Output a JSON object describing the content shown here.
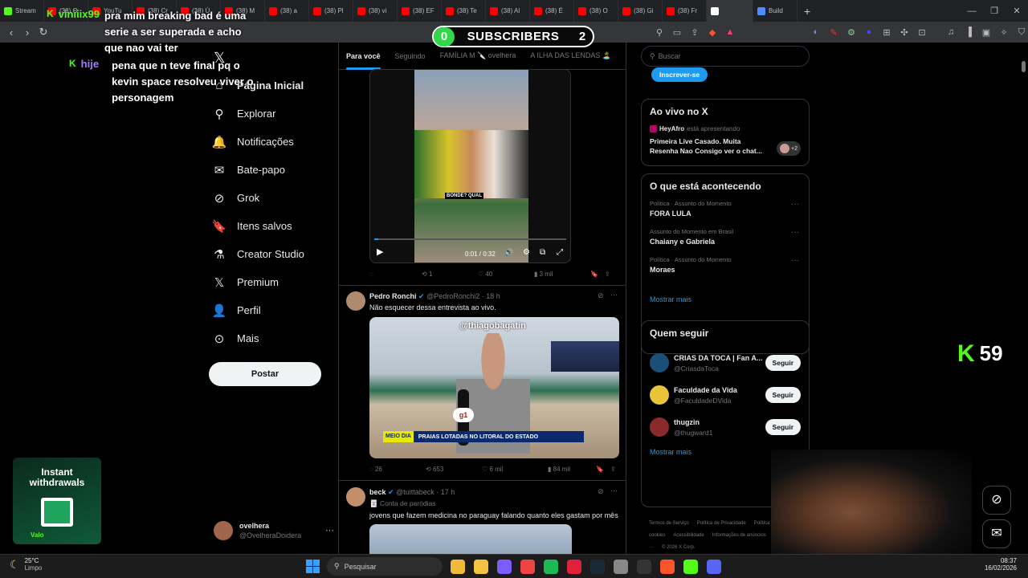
{
  "browser": {
    "tabs": [
      {
        "label": "Stream",
        "color": "#53fc18"
      },
      {
        "label": "(38) O",
        "color": "#ff0000"
      },
      {
        "label": "YouTu",
        "color": "#ff0000"
      },
      {
        "label": "(38) Cr",
        "color": "#ff0000"
      },
      {
        "label": "(38) Ú",
        "color": "#ff0000"
      },
      {
        "label": "(38) M",
        "color": "#ff0000"
      },
      {
        "label": "(38) a",
        "color": "#ff0000"
      },
      {
        "label": "(38) Pl",
        "color": "#ff0000"
      },
      {
        "label": "(38) vi",
        "color": "#ff0000"
      },
      {
        "label": "(38) EF",
        "color": "#ff0000"
      },
      {
        "label": "(38) Te",
        "color": "#ff0000"
      },
      {
        "label": "(38) Al",
        "color": "#ff0000"
      },
      {
        "label": "(38) É",
        "color": "#ff0000"
      },
      {
        "label": "(38) O",
        "color": "#ff0000"
      },
      {
        "label": "(38) Gi",
        "color": "#ff0000"
      },
      {
        "label": "(38) Fr",
        "color": "#ff0000"
      },
      {
        "label": "",
        "color": "#ffffff"
      },
      {
        "label": "Build",
        "color": "#4f8cff"
      }
    ],
    "new_tab": "+"
  },
  "overlay": {
    "chat": [
      {
        "user": "viniiix99",
        "message": "pra mim breaking bad é uma serie a ser superada e acho que nao vai ter",
        "user_color": "#53fc18"
      },
      {
        "user": "hije",
        "message": "pena que n teve final pq o kevin space resolveu viver o personagem",
        "user_color": "#a77bff"
      }
    ],
    "subscribers": {
      "current": "0",
      "label": "SUBSCRIBERS",
      "goal": "2"
    },
    "kick_counter": "59",
    "ad": {
      "title": "Instant withdrawals",
      "tag": "Valo"
    }
  },
  "x": {
    "nav": [
      {
        "label": "Página Inicial",
        "icon": "home-icon",
        "glyph": "⌂"
      },
      {
        "label": "Explorar",
        "icon": "search-icon",
        "glyph": "⚲"
      },
      {
        "label": "Notificações",
        "icon": "bell-icon",
        "glyph": "🔔"
      },
      {
        "label": "Bate-papo",
        "icon": "mail-icon",
        "glyph": "✉"
      },
      {
        "label": "Grok",
        "icon": "grok-icon",
        "glyph": "⊘"
      },
      {
        "label": "Itens salvos",
        "icon": "bookmark-icon",
        "glyph": "🔖"
      },
      {
        "label": "Creator Studio",
        "icon": "flask-icon",
        "glyph": "⚗"
      },
      {
        "label": "Premium",
        "icon": "x-logo-icon",
        "glyph": "𝕏"
      },
      {
        "label": "Perfil",
        "icon": "person-icon",
        "glyph": "👤"
      },
      {
        "label": "Mais",
        "icon": "more-circle-icon",
        "glyph": "⊙"
      }
    ],
    "post_button": "Postar",
    "account": {
      "name": "ovelhera",
      "handle": "@OvelheraDoidera"
    },
    "feed_tabs": [
      "Para você",
      "Seguindo",
      "FAMÍLIA M 🔪 ovelhera",
      "A ILHA DAS LENDAS 🏝️"
    ],
    "video1": {
      "caption": "BONDE? QUAL",
      "time": "0:01 / 0:32",
      "replies": "",
      "reposts": "1",
      "likes": "40",
      "views": "3 mil"
    },
    "tweet2": {
      "name": "Pedro Ronchi",
      "handle": "@PedroRonchi2",
      "time": "· 18 h",
      "text": "Não esquecer dessa entrevista ao vivo.",
      "overlay_handle": "@thiagobagatin",
      "headline": "PRAIAS LOTADAS NO LITORAL DO ESTADO",
      "show": "MEIO DIA",
      "replies": "26",
      "reposts": "653",
      "likes": "6 mil",
      "views": "84 mil"
    },
    "tweet3": {
      "name": "beck",
      "handle": "@tuittabeck",
      "time": "· 17 h",
      "parody": "Conta de paródias",
      "text": "jovens que fazem medicina no paraguay falando quanto eles gastam por mês"
    },
    "search_placeholder": "Buscar",
    "subscribe_button": "Inscrever-se",
    "live": {
      "title": "Ao vivo no X",
      "host": "HeyAfro",
      "status": "está apresentando",
      "text": "Primeira Live Casado. Muita Resenha Nao Consigo ver o chat...",
      "extra": "+2"
    },
    "happening": {
      "title": "O que está acontecendo",
      "trends": [
        {
          "category": "Política · Assunto do Momento",
          "name": "FORA LULA"
        },
        {
          "category": "Assunto do Momento em Brasil",
          "name": "Chaiany e Gabriela"
        },
        {
          "category": "Política · Assunto do Momento",
          "name": "Moraes"
        }
      ],
      "more": "Mostrar mais"
    },
    "who_to_follow": {
      "title": "Quem seguir",
      "users": [
        {
          "name": "CRIAS DA TOCA | Fan A...",
          "handle": "@CriasdaToca",
          "button": "Seguir"
        },
        {
          "name": "Faculdade da Vida",
          "handle": "@FaculdadeDVida",
          "button": "Seguir"
        },
        {
          "name": "thugzin",
          "handle": "@thugward1",
          "button": "Seguir"
        }
      ],
      "more": "Mostrar mais"
    },
    "footer": [
      "Termos de Serviço",
      "Política de Privacidade",
      "Política de cookies",
      "Acessibilidade",
      "Informações de anúncios",
      "Mais ···",
      "© 2026 X Corp."
    ]
  },
  "taskbar": {
    "weather_temp": "25°C",
    "weather_desc": "Limpo",
    "search_placeholder": "Pesquisar",
    "time": "08:37",
    "date": "16/02/2026"
  }
}
